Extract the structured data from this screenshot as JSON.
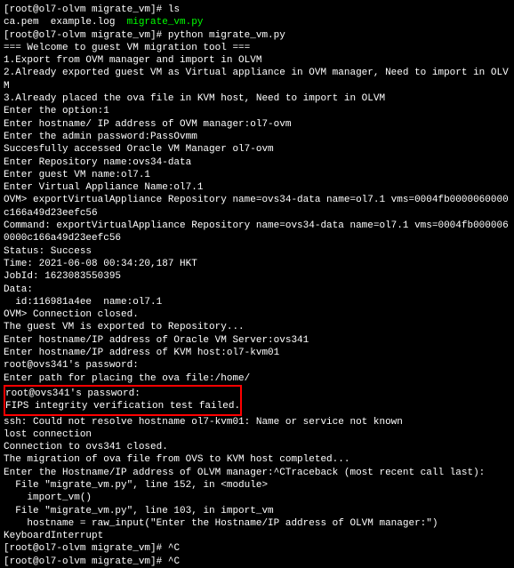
{
  "lines": {
    "l1_prompt": "[root@ol7-olvm migrate_vm]# ",
    "l1_cmd": "ls",
    "l2": "ca.pem  example.log  ",
    "l2_green": "migrate_vm.py",
    "l3_prompt": "[root@ol7-olvm migrate_vm]# ",
    "l3_cmd": "python migrate_vm.py",
    "l4": "=== Welcome to guest VM migration tool ===",
    "l5": "1.Export from OVM manager and import in OLVM",
    "l6": "",
    "l7": "2.Already exported guest VM as Virtual appliance in OVM manager, Need to import in OLVM",
    "l8": "",
    "l9": "3.Already placed the ova file in KVM host, Need to import in OLVM",
    "l10": "",
    "l11": "Enter the option:1",
    "l12": "Enter hostname/ IP address of OVM manager:ol7-ovm",
    "l13": "Enter the admin password:PassOvmm",
    "l14": "Succesfully accessed Oracle VM Manager ol7-ovm",
    "l15": "Enter Repository name:ovs34-data",
    "l16": "Enter guest VM name:ol7.1",
    "l17": "Enter Virtual Appliance Name:ol7.1",
    "l18": "OVM> exportVirtualAppliance Repository name=ovs34-data name=ol7.1 vms=0004fb0000060000c166a49d23eefc56",
    "l19": "Command: exportVirtualAppliance Repository name=ovs34-data name=ol7.1 vms=0004fb0000060000c166a49d23eefc56",
    "l20": "Status: Success",
    "l21": "Time: 2021-06-08 00:34:20,187 HKT",
    "l22": "JobId: 1623083550395",
    "l23": "Data:",
    "l24": "  id:116981a4ee  name:ol7.1",
    "l25": "OVM> Connection closed.",
    "l26": "",
    "l27": "The guest VM is exported to Repository...",
    "l28": "",
    "l29": "Enter hostname/IP address of Oracle VM Server:ovs341",
    "l30": "Enter hostname/IP address of KVM host:ol7-kvm01",
    "l31": "root@ovs341's password:",
    "l32": "Enter path for placing the ova file:/home/",
    "l33": "root@ovs341's password:",
    "l34": "FIPS integrity verification test failed.",
    "l35": "ssh: Could not resolve hostname ol7-kvm01: Name or service not known",
    "l36": "lost connection",
    "l37": "Connection to ovs341 closed.",
    "l38": "The migration of ova file from OVS to KVM host completed...",
    "l39": "",
    "l40": "Enter the Hostname/IP address of OLVM manager:^CTraceback (most recent call last):",
    "l41": "  File \"migrate_vm.py\", line 152, in <module>",
    "l42": "    import_vm()",
    "l43": "  File \"migrate_vm.py\", line 103, in import_vm",
    "l44": "    hostname = raw_input(\"Enter the Hostname/IP address of OLVM manager:\")",
    "l45": "KeyboardInterrupt",
    "l46_prompt": "[root@ol7-olvm migrate_vm]# ",
    "l46_cmd": "^C",
    "l47_prompt": "[root@ol7-olvm migrate_vm]# ",
    "l47_cmd": "^C"
  }
}
